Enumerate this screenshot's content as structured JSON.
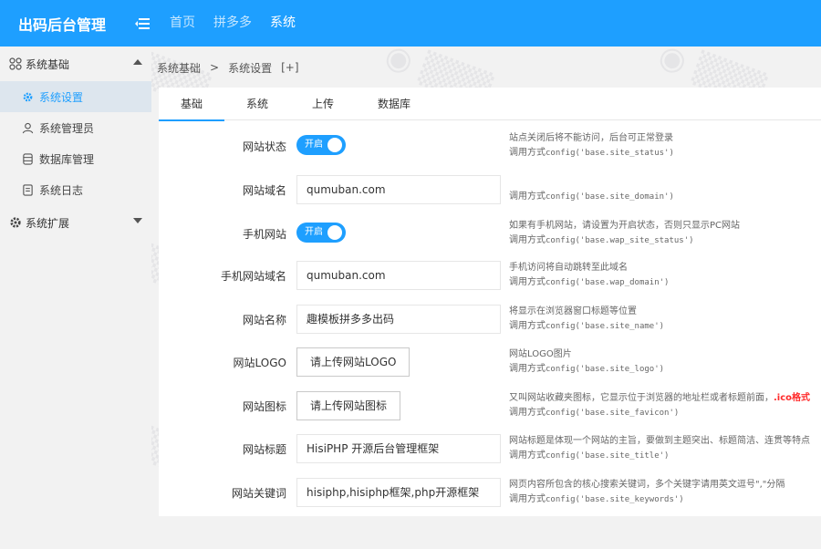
{
  "header": {
    "brand": "出码后台管理",
    "nav": [
      {
        "label": "首页",
        "active": false
      },
      {
        "label": "拼多多",
        "active": false
      },
      {
        "label": "系统",
        "active": true
      }
    ]
  },
  "sidebar": {
    "group1": "系统基础",
    "items": [
      "系统设置",
      "系统管理员",
      "数据库管理",
      "系统日志"
    ],
    "group2": "系统扩展"
  },
  "breadcrumb": {
    "a": "系统基础",
    "sep": ">",
    "b": "系统设置",
    "extra": "[+]"
  },
  "tabs": [
    "基础",
    "系统",
    "上传",
    "数据库"
  ],
  "form": {
    "site_status": {
      "label": "网站状态",
      "switch": "开启",
      "tip1": "站点关闭后将不能访问，后台可正常登录",
      "tip2_prefix": "调用方式",
      "tip2_code": "config('base.site_status')"
    },
    "site_domain": {
      "label": "网站域名",
      "value": "qumuban.com",
      "tip2_prefix": "调用方式",
      "tip2_code": "config('base.site_domain')"
    },
    "wap_status": {
      "label": "手机网站",
      "switch": "开启",
      "tip1": "如果有手机网站，请设置为开启状态，否则只显示PC网站",
      "tip2_prefix": "调用方式",
      "tip2_code": "config('base.wap_site_status')"
    },
    "wap_domain": {
      "label": "手机网站域名",
      "value": "qumuban.com",
      "tip1": "手机访问将自动跳转至此域名",
      "tip2_prefix": "调用方式",
      "tip2_code": "config('base.wap_domain')"
    },
    "site_name": {
      "label": "网站名称",
      "value": "趣模板拼多多出码",
      "tip1": "将显示在浏览器窗口标题等位置",
      "tip2_prefix": "调用方式",
      "tip2_code": "config('base.site_name')"
    },
    "site_logo": {
      "label": "网站LOGO",
      "button": "请上传网站LOGO",
      "tip1": "网站LOGO图片",
      "tip2_prefix": "调用方式",
      "tip2_code": "config('base.site_logo')"
    },
    "site_favicon": {
      "label": "网站图标",
      "button": "请上传网站图标",
      "tip1": "又叫网站收藏夹图标，它显示位于浏览器的地址栏或者标题前面，",
      "tip1_hl": ".ico格式",
      "tip2_prefix": "调用方式",
      "tip2_code": "config('base.site_favicon')"
    },
    "site_title": {
      "label": "网站标题",
      "value": "HisiPHP 开源后台管理框架",
      "tip1": "网站标题是体现一个网站的主旨，要做到主题突出、标题简洁、连贯等特点",
      "tip2_prefix": "调用方式",
      "tip2_code": "config('base.site_title')"
    },
    "site_keywords": {
      "label": "网站关键词",
      "value": "hisiphp,hisiphp框架,php开源框架",
      "tip1": "网页内容所包含的核心搜索关键词，多个关键字请用英文逗号\",\"分隔",
      "tip2_prefix": "调用方式",
      "tip2_code": "config('base.site_keywords')"
    }
  },
  "colors": {
    "primary": "#1e9fff",
    "active_bg": "#dde6ee",
    "highlight": "#ff2b2b"
  }
}
